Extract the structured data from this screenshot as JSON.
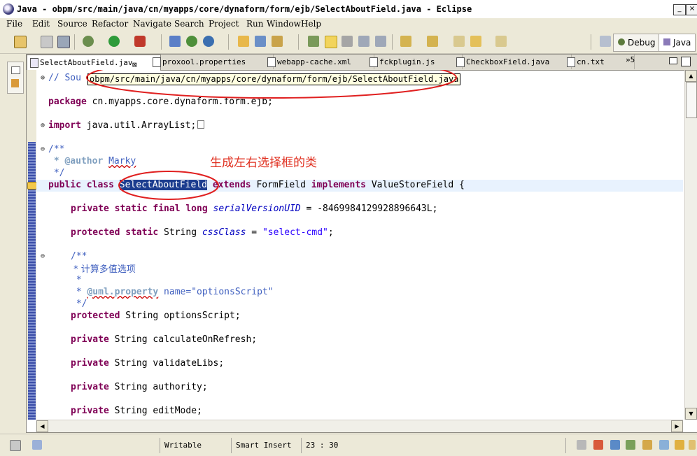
{
  "window": {
    "title": "Java - obpm/src/main/java/cn/myapps/core/dynaform/form/ejb/SelectAboutField.java - Eclipse",
    "minimize": "_",
    "close": "×"
  },
  "menu": [
    "File",
    "Edit",
    "Source",
    "Refactor",
    "Navigate",
    "Search",
    "Project",
    "Run",
    "Window",
    "Help"
  ],
  "perspectives": {
    "debug": "Debug",
    "java": "Java"
  },
  "tabs": [
    {
      "label": "SelectAboutField.jav",
      "active": true
    },
    {
      "label": "proxool.properties"
    },
    {
      "label": "webapp-cache.xml"
    },
    {
      "label": "fckplugin.js"
    },
    {
      "label": "CheckboxField.java"
    },
    {
      "label": "cn.txt"
    }
  ],
  "tabs_overflow": "»5",
  "tooltip": "obpm/src/main/java/cn/myapps/core/dynaform/form/ejb/SelectAboutField.java",
  "annotation": "生成左右选择框的类",
  "code": {
    "l1": "// Sou",
    "package_kw": "package",
    "package_name": " cn.myapps.core.dynaform.form.ejb;",
    "import_kw": "import",
    "import_name": " java.util.ArrayList;",
    "doc_open": "/**",
    "author_tag": " * @author",
    "author_name": "Marky",
    "doc_close": " */",
    "class_public": "public",
    "class_kw": "class",
    "class_name": "SelectAboutField",
    "extends_kw": "extends",
    "form_field": " FormField ",
    "implements_kw": "implements",
    "implements_rest": " ValueStoreField {",
    "serial_mods": "private static final long",
    "serial_name": "serialVersionUID",
    "serial_value": " = -8469984129928896643L;",
    "css_mods": "protected static",
    "css_type": " String ",
    "css_name": "cssClass",
    "css_eq": " = ",
    "css_value": "\"select-cmd\"",
    "semicolon": ";",
    "doc2_open": "/**",
    "doc2_line": " * 计算多值选项",
    "doc2_star": " *",
    "uml_tag": "@uml.property",
    "uml_attr": " name=",
    "uml_value": "\"optionsScript\"",
    "doc2_close": " */",
    "f1_kw": "protected",
    "f1_rest": " String optionsScript;",
    "f2_kw": "private",
    "f2_rest": " String calculateOnRefresh;",
    "f3_kw": "private",
    "f3_rest": " String validateLibs;",
    "f4_kw": "private",
    "f4_rest": " String authority;",
    "f5_kw": "private",
    "f5_rest": " String editMode;"
  },
  "status": {
    "writable": "Writable",
    "insert": "Smart Insert",
    "position": "23 : 30"
  },
  "colors": {
    "keyword": "#7f0055",
    "comment": "#3f5fbf",
    "string": "#2a00ff",
    "annotation": "#e03020",
    "selection": "#1c3d8f"
  }
}
